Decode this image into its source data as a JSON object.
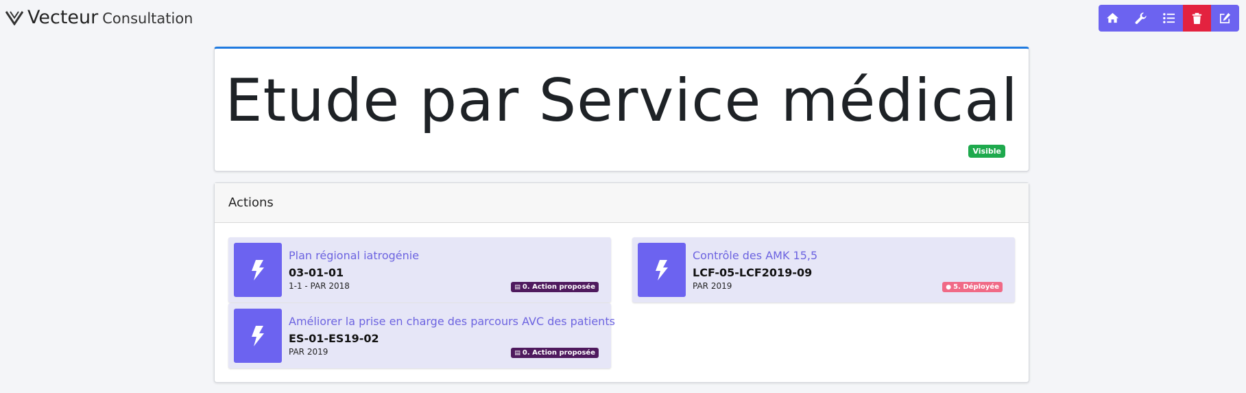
{
  "brand": {
    "name": "Vecteur",
    "subtitle": "Consultation",
    "logo_icon": "vecteur-v-logo"
  },
  "toolbar": {
    "buttons": [
      {
        "icon": "home-icon"
      },
      {
        "icon": "wrench-icon"
      },
      {
        "icon": "list-icon"
      },
      {
        "icon": "trash-icon",
        "color": "#e3223f"
      },
      {
        "icon": "edit-icon"
      }
    ],
    "accent": "#6c63f0"
  },
  "page": {
    "title": "Etude par Service médical",
    "visibility_badge": "Visible"
  },
  "actions_section": {
    "heading": "Actions",
    "items": [
      {
        "title": "Plan régional iatrogénie",
        "code": "03-01-01",
        "meta": "1-1 - PAR 2018",
        "status": "0. Action proposée",
        "status_color": "#4f1a5e"
      },
      {
        "title": "Améliorer la prise en charge des parcours AVC des patients",
        "code": "ES-01-ES19-02",
        "meta": "PAR 2019",
        "status": "0. Action proposée",
        "status_color": "#4f1a5e"
      },
      {
        "title": "Contrôle des AMK 15,5",
        "code": "LCF-05-LCF2019-09",
        "meta": "PAR 2019",
        "status": "5. Déployée",
        "status_color": "#f06a86"
      }
    ]
  }
}
